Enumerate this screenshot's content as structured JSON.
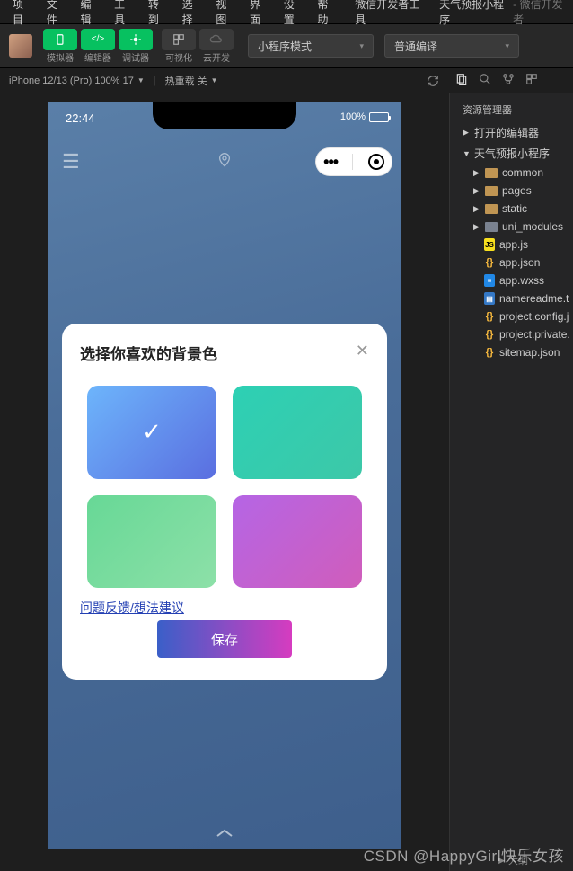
{
  "menubar": {
    "items": [
      "项目",
      "文件",
      "编辑",
      "工具",
      "转到",
      "选择",
      "视图",
      "界面",
      "设置",
      "帮助"
    ],
    "app_name": "微信开发者工具",
    "project_name": "天气预报小程序",
    "project_sub": "- 微信开发者"
  },
  "toolbar": {
    "simulator_label": "模拟器",
    "editor_label": "编辑器",
    "debugger_label": "调试器",
    "visual_label": "可视化",
    "cloud_label": "云开发",
    "mode_dropdown": "小程序模式",
    "compile_dropdown": "普通编译"
  },
  "statusbar": {
    "device": "iPhone 12/13 (Pro) 100% 17",
    "reload": "热重载 关"
  },
  "phone": {
    "time": "22:44",
    "battery_pct": "100%"
  },
  "modal": {
    "title": "选择你喜欢的背景色",
    "feedback_link": "问题反馈/想法建议",
    "save_label": "保存"
  },
  "sidebar": {
    "panel_title": "资源管理器",
    "opened_editors": "打开的编辑器",
    "project_root": "天气预报小程序",
    "folders": [
      "common",
      "pages",
      "static",
      "uni_modules"
    ],
    "files": [
      {
        "name": "app.js",
        "type": "js"
      },
      {
        "name": "app.json",
        "type": "json"
      },
      {
        "name": "app.wxss",
        "type": "wxss"
      },
      {
        "name": "namereadme.t",
        "type": "txt"
      },
      {
        "name": "project.config.j",
        "type": "json"
      },
      {
        "name": "project.private.",
        "type": "json"
      },
      {
        "name": "sitemap.json",
        "type": "json"
      }
    ],
    "outline_label": "大纲"
  },
  "watermark": "CSDN @HappyGirl快乐女孩"
}
